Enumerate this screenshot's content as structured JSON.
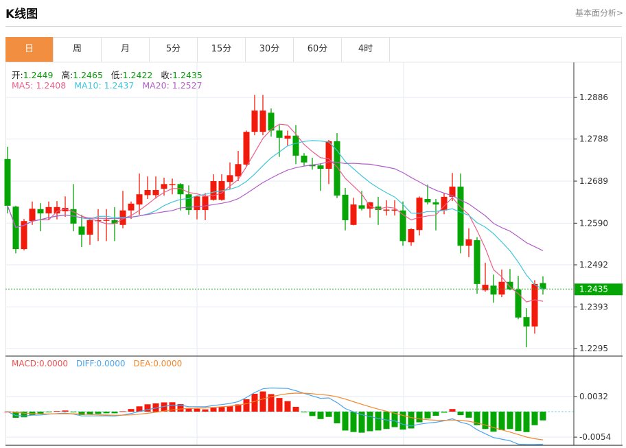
{
  "header": {
    "title": "K线图",
    "fundamental_link": "基本面分析>"
  },
  "tabs": [
    {
      "label": "日",
      "active": true
    },
    {
      "label": "周"
    },
    {
      "label": "月"
    },
    {
      "label": "5分"
    },
    {
      "label": "15分"
    },
    {
      "label": "30分"
    },
    {
      "label": "60分"
    },
    {
      "label": "4时"
    }
  ],
  "ohlc_info": {
    "open_label": "开:",
    "open": "1.2449",
    "high_label": "高:",
    "high": "1.2465",
    "low_label": "低:",
    "low": "1.2422",
    "close_label": "收:",
    "close": "1.2435"
  },
  "ma_info": {
    "ma5": "MA5: 1.2408",
    "ma10": "MA10: 1.2437",
    "ma20": "MA20: 1.2527"
  },
  "macd_info": {
    "macd": "MACD:0.0000",
    "diff": "DIFF:0.0000",
    "dea": "DEA:0.0000"
  },
  "colors": {
    "up": "#f21a0a",
    "down": "#05a505",
    "ma5": "#ec5f8a",
    "ma10": "#3fc6da",
    "ma20": "#b25fc7",
    "diff": "#4aa5ee",
    "dea": "#f5862b",
    "accent": "#f28e3f"
  },
  "chart_data": {
    "type": "candlestick",
    "price_axis": {
      "ticks": [
        "1.2886",
        "1.2788",
        "1.2689",
        "1.2590",
        "1.2492",
        "1.2393",
        "1.2295"
      ],
      "range": [
        1.2295,
        1.2886
      ]
    },
    "last_price_tag": "1.2435",
    "macd_axis": {
      "ticks": [
        "0.0032",
        "-0.0054"
      ]
    },
    "candles": [
      [
        1.2741,
        1.277,
        1.2613,
        1.2631
      ],
      [
        1.2629,
        1.2631,
        1.2519,
        1.2529
      ],
      [
        1.2529,
        1.26,
        1.2526,
        1.2595
      ],
      [
        1.2595,
        1.2641,
        1.2586,
        1.2624
      ],
      [
        1.2623,
        1.2637,
        1.2571,
        1.2613
      ],
      [
        1.2613,
        1.2641,
        1.2597,
        1.2628
      ],
      [
        1.2613,
        1.2642,
        1.2599,
        1.2628
      ],
      [
        1.2618,
        1.2653,
        1.2605,
        1.2626
      ],
      [
        1.2623,
        1.2682,
        1.2571,
        1.2589
      ],
      [
        1.2582,
        1.261,
        1.2534,
        1.2563
      ],
      [
        1.2563,
        1.2603,
        1.2539,
        1.2597
      ],
      [
        1.2596,
        1.2623,
        1.2548,
        1.2597
      ],
      [
        1.2596,
        1.2623,
        1.2548,
        1.2598
      ],
      [
        1.2597,
        1.2628,
        1.2548,
        1.2589
      ],
      [
        1.2586,
        1.2666,
        1.2578,
        1.262
      ],
      [
        1.262,
        1.2641,
        1.26,
        1.2636
      ],
      [
        1.2634,
        1.2707,
        1.261,
        1.2658
      ],
      [
        1.2656,
        1.27,
        1.2647,
        1.2668
      ],
      [
        1.2656,
        1.27,
        1.2648,
        1.2668
      ],
      [
        1.2671,
        1.2697,
        1.2655,
        1.2682
      ],
      [
        1.2681,
        1.2695,
        1.2658,
        1.2682
      ],
      [
        1.2682,
        1.2684,
        1.262,
        1.2658
      ],
      [
        1.2658,
        1.2679,
        1.261,
        1.2621
      ],
      [
        1.2621,
        1.2655,
        1.2599,
        1.2653
      ],
      [
        1.2621,
        1.2661,
        1.2597,
        1.2653
      ],
      [
        1.2645,
        1.2705,
        1.2643,
        1.2689
      ],
      [
        1.2645,
        1.2705,
        1.2643,
        1.2689
      ],
      [
        1.2687,
        1.2733,
        1.267,
        1.2703
      ],
      [
        1.27,
        1.276,
        1.2689,
        1.2729
      ],
      [
        1.2728,
        1.2808,
        1.2723,
        1.2805
      ],
      [
        1.2805,
        1.2892,
        1.2797,
        1.2855
      ],
      [
        1.2805,
        1.2892,
        1.2797,
        1.2855
      ],
      [
        1.285,
        1.286,
        1.2794,
        1.2808
      ],
      [
        1.2808,
        1.2821,
        1.2746,
        1.2791
      ],
      [
        1.2789,
        1.2808,
        1.2773,
        1.2796
      ],
      [
        1.2796,
        1.2821,
        1.2729,
        1.2749
      ],
      [
        1.2749,
        1.2755,
        1.2724,
        1.2733
      ],
      [
        1.2728,
        1.2744,
        1.2716,
        1.2724
      ],
      [
        1.2726,
        1.2731,
        1.2666,
        1.2718
      ],
      [
        1.2718,
        1.2786,
        1.2682,
        1.2783
      ],
      [
        1.2783,
        1.2802,
        1.2649,
        1.2655
      ],
      [
        1.2657,
        1.2673,
        1.2573,
        1.2597
      ],
      [
        1.2586,
        1.265,
        1.2585,
        1.2634
      ],
      [
        1.2632,
        1.2666,
        1.262,
        1.2624
      ],
      [
        1.2624,
        1.264,
        1.2603,
        1.2639
      ],
      [
        1.2629,
        1.2652,
        1.2586,
        1.2621
      ],
      [
        1.2621,
        1.2644,
        1.2608,
        1.2622
      ],
      [
        1.2621,
        1.2644,
        1.2608,
        1.2622
      ],
      [
        1.262,
        1.2641,
        1.2537,
        1.2548
      ],
      [
        1.2545,
        1.2578,
        1.2537,
        1.2576
      ],
      [
        1.2574,
        1.2653,
        1.2561,
        1.265
      ],
      [
        1.2647,
        1.2681,
        1.2634,
        1.2639
      ],
      [
        1.2639,
        1.2647,
        1.2573,
        1.2634
      ],
      [
        1.262,
        1.266,
        1.2611,
        1.2652
      ],
      [
        1.2652,
        1.2708,
        1.2642,
        1.2676
      ],
      [
        1.2676,
        1.2707,
        1.2519,
        1.2537
      ],
      [
        1.2537,
        1.2578,
        1.251,
        1.2552
      ],
      [
        1.255,
        1.2557,
        1.2424,
        1.2447
      ],
      [
        1.2432,
        1.2497,
        1.2429,
        1.2445
      ],
      [
        1.2443,
        1.2469,
        1.2403,
        1.2422
      ],
      [
        1.2422,
        1.2481,
        1.2416,
        1.2452
      ],
      [
        1.2452,
        1.2482,
        1.2432,
        1.2434
      ],
      [
        1.2434,
        1.2466,
        1.2364,
        1.2368
      ],
      [
        1.2369,
        1.239,
        1.2298,
        1.2347
      ],
      [
        1.2347,
        1.2456,
        1.233,
        1.2447
      ],
      [
        1.2449,
        1.2465,
        1.2422,
        1.2435
      ]
    ]
  }
}
